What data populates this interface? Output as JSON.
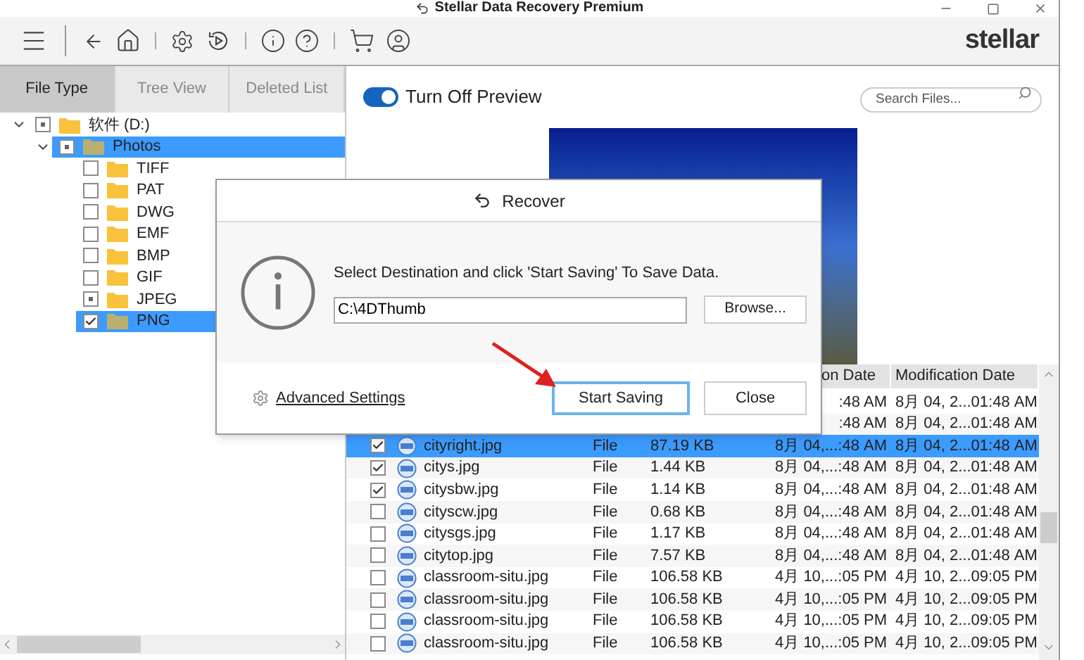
{
  "window": {
    "title": "Stellar Data Recovery Premium"
  },
  "brand": {
    "logo": "stellar"
  },
  "tabs": [
    {
      "label": "File Type",
      "selected": true
    },
    {
      "label": "Tree View",
      "selected": false
    },
    {
      "label": "Deleted List",
      "selected": false
    }
  ],
  "tree": [
    {
      "label": "软件 (D:)",
      "expanded": true,
      "checked": false,
      "mixed": true,
      "selected": false,
      "children": [
        {
          "label": "Photos",
          "expanded": true,
          "checked": false,
          "mixed": true,
          "selected": true,
          "children": [
            {
              "label": "TIFF",
              "checked": false,
              "mixed": false,
              "selected": false
            },
            {
              "label": "PAT",
              "checked": false,
              "mixed": false,
              "selected": false
            },
            {
              "label": "DWG",
              "checked": false,
              "mixed": false,
              "selected": false
            },
            {
              "label": "EMF",
              "checked": false,
              "mixed": false,
              "selected": false
            },
            {
              "label": "BMP",
              "checked": false,
              "mixed": false,
              "selected": false
            },
            {
              "label": "GIF",
              "checked": false,
              "mixed": false,
              "selected": false
            },
            {
              "label": "JPEG",
              "checked": false,
              "mixed": true,
              "selected": false
            },
            {
              "label": "PNG",
              "checked": true,
              "mixed": false,
              "selected": true
            }
          ]
        }
      ]
    }
  ],
  "preview": {
    "toggle_label": "Turn Off Preview",
    "on": true
  },
  "search": {
    "placeholder": "Search Files..."
  },
  "table": {
    "columns": [
      "on Date",
      "Modification Date"
    ],
    "rows": [
      {
        "kind": "partial",
        "created": ":48 AM",
        "modified": "8月 04, 2...01:48 AM"
      },
      {
        "kind": "partial",
        "created": ":48 AM",
        "modified": "8月 04, 2...01:48 AM"
      },
      {
        "kind": "full",
        "name": "cityright.jpg",
        "type": "File",
        "size": "87.19 KB",
        "created": "8月 04,...:48 AM",
        "modified": "8月 04, 2...01:48 AM",
        "checked": true,
        "selected": true
      },
      {
        "kind": "full",
        "name": "citys.jpg",
        "type": "File",
        "size": "1.44 KB",
        "created": "8月 04,...:48 AM",
        "modified": "8月 04, 2...01:48 AM",
        "checked": true,
        "selected": false
      },
      {
        "kind": "full",
        "name": "citysbw.jpg",
        "type": "File",
        "size": "1.14 KB",
        "created": "8月 04,...:48 AM",
        "modified": "8月 04, 2...01:48 AM",
        "checked": true,
        "selected": false
      },
      {
        "kind": "full",
        "name": "cityscw.jpg",
        "type": "File",
        "size": "0.68 KB",
        "created": "8月 04,...:48 AM",
        "modified": "8月 04, 2...01:48 AM",
        "checked": false,
        "selected": false
      },
      {
        "kind": "full",
        "name": "citysgs.jpg",
        "type": "File",
        "size": "1.17 KB",
        "created": "8月 04,...:48 AM",
        "modified": "8月 04, 2...01:48 AM",
        "checked": false,
        "selected": false
      },
      {
        "kind": "full",
        "name": "citytop.jpg",
        "type": "File",
        "size": "7.57 KB",
        "created": "8月 04,...:48 AM",
        "modified": "8月 04, 2...01:48 AM",
        "checked": false,
        "selected": false
      },
      {
        "kind": "full",
        "name": "classroom-situ.jpg",
        "type": "File",
        "size": "106.58 KB",
        "created": "4月 10,...:05 PM",
        "modified": "4月 10, 2...09:05 PM",
        "checked": false,
        "selected": false
      },
      {
        "kind": "full",
        "name": "classroom-situ.jpg",
        "type": "File",
        "size": "106.58 KB",
        "created": "4月 10,...:05 PM",
        "modified": "4月 10, 2...09:05 PM",
        "checked": false,
        "selected": false
      },
      {
        "kind": "full",
        "name": "classroom-situ.jpg",
        "type": "File",
        "size": "106.58 KB",
        "created": "4月 10,...:05 PM",
        "modified": "4月 10, 2...09:05 PM",
        "checked": false,
        "selected": false
      },
      {
        "kind": "full",
        "name": "classroom-situ.jpg",
        "type": "File",
        "size": "106.58 KB",
        "created": "4月 10,...:05 PM",
        "modified": "4月 10, 2...09:05 PM",
        "checked": false,
        "selected": false
      }
    ]
  },
  "dialog": {
    "title": "Recover",
    "message": "Select Destination and click 'Start Saving' To Save Data.",
    "path_value": "C:\\4DThumb",
    "browse": "Browse...",
    "advanced_settings": "Advanced Settings",
    "start_saving": "Start Saving",
    "close": "Close"
  }
}
